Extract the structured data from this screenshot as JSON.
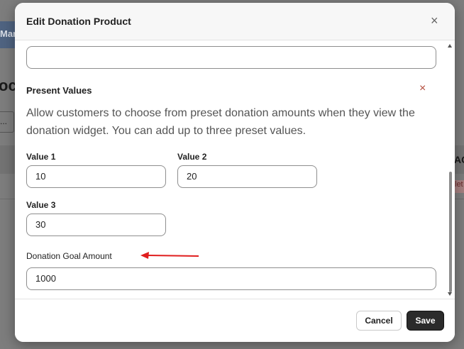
{
  "background": {
    "nav_text": "Mar",
    "heading": "oc",
    "select_text": "...",
    "right_text": "AC",
    "right_badge": "let"
  },
  "modal": {
    "title": "Edit Donation Product",
    "close_icon": "×"
  },
  "top_field": {
    "value": ""
  },
  "present_values": {
    "title": "Present Values",
    "remove_icon": "×",
    "helper_text": "Allow customers to choose from preset donation amounts when they view the donation widget. You can add up to three preset values.",
    "value1": {
      "label": "Value 1",
      "value": "10"
    },
    "value2": {
      "label": "Value 2",
      "value": "20"
    },
    "value3": {
      "label": "Value 3",
      "value": "30"
    }
  },
  "donation_goal": {
    "label": "Donation Goal Amount",
    "value": "1000"
  },
  "footer": {
    "cancel_label": "Cancel",
    "save_label": "Save"
  },
  "annotation": {
    "arrow_color": "#e01e1e"
  }
}
